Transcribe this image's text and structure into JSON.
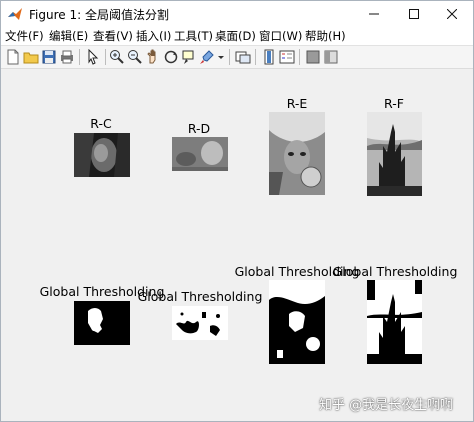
{
  "window": {
    "title": "Figure 1: 全局阈值法分割"
  },
  "menubar": {
    "items": [
      "文件(F)",
      "编辑(E)",
      "查看(V)",
      "插入(I)",
      "工具(T)",
      "桌面(D)",
      "窗口(W)",
      "帮助(H)"
    ]
  },
  "toolbar": {
    "icons": [
      "new-figure-icon",
      "open-file-icon",
      "save-icon",
      "print-icon",
      "pointer-icon",
      "zoom-in-icon",
      "zoom-out-icon",
      "pan-icon",
      "rotate-3d-icon",
      "data-cursor-icon",
      "brush-icon",
      "brush-dropdown-icon",
      "link-plot-icon",
      "colorbar-icon",
      "legend-icon",
      "hide-plot-tools-icon",
      "show-plot-tools-icon"
    ]
  },
  "plots": {
    "top_titles": [
      "R-C",
      "R-D",
      "R-E",
      "R-F"
    ],
    "bottom_titles": [
      "Global Thresholding",
      "Global Thresholding",
      "Global Thresholding",
      "Global Thresholding"
    ]
  },
  "watermark": "知乎 @我是长夜生啊啊"
}
